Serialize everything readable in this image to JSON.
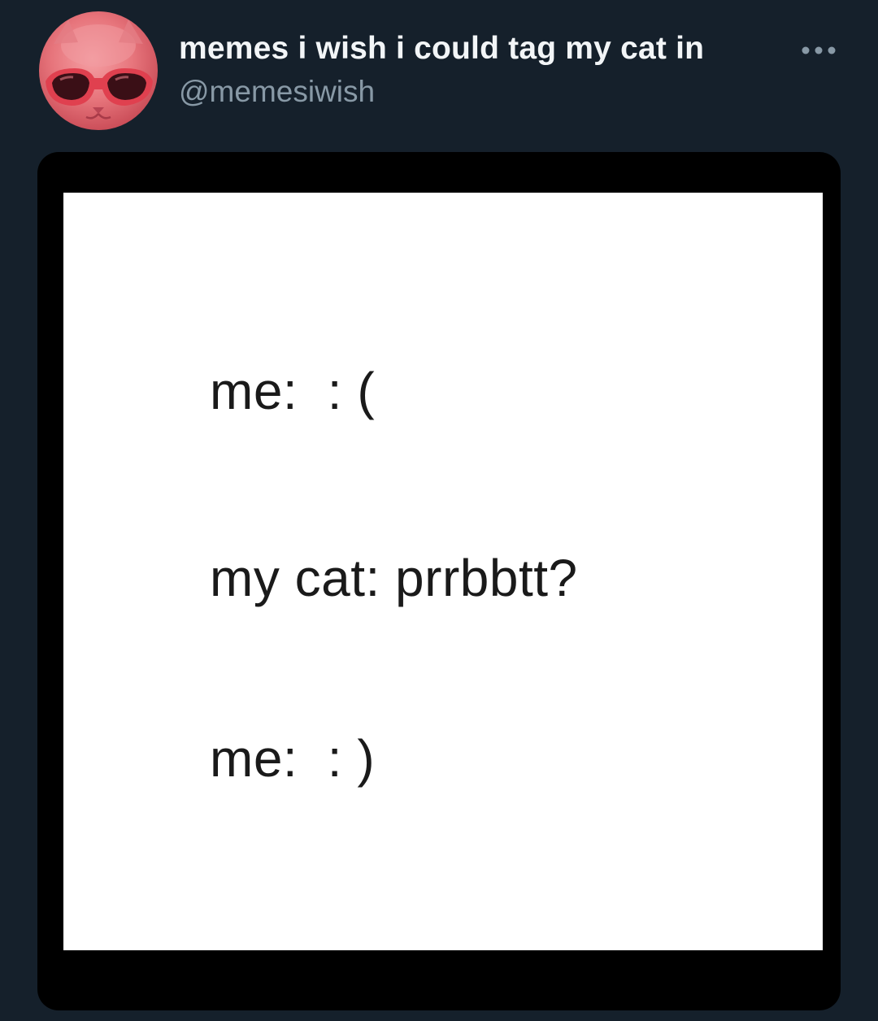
{
  "tweet": {
    "display_name": "memes i wish i could tag my cat in",
    "handle": "@memesiwish",
    "more_icon": "more-horizontal-icon",
    "avatar_icon": "cat-with-sunglasses-avatar"
  },
  "meme": {
    "lines": [
      "me:  : (",
      "my cat: prrbbtt?",
      "me:  : )"
    ]
  },
  "colors": {
    "background": "#15202b",
    "name_text": "#f2f5f7",
    "handle_text": "#8899a6",
    "media_frame": "#000000",
    "meme_background": "#ffffff",
    "meme_text": "#1a1a1a"
  }
}
